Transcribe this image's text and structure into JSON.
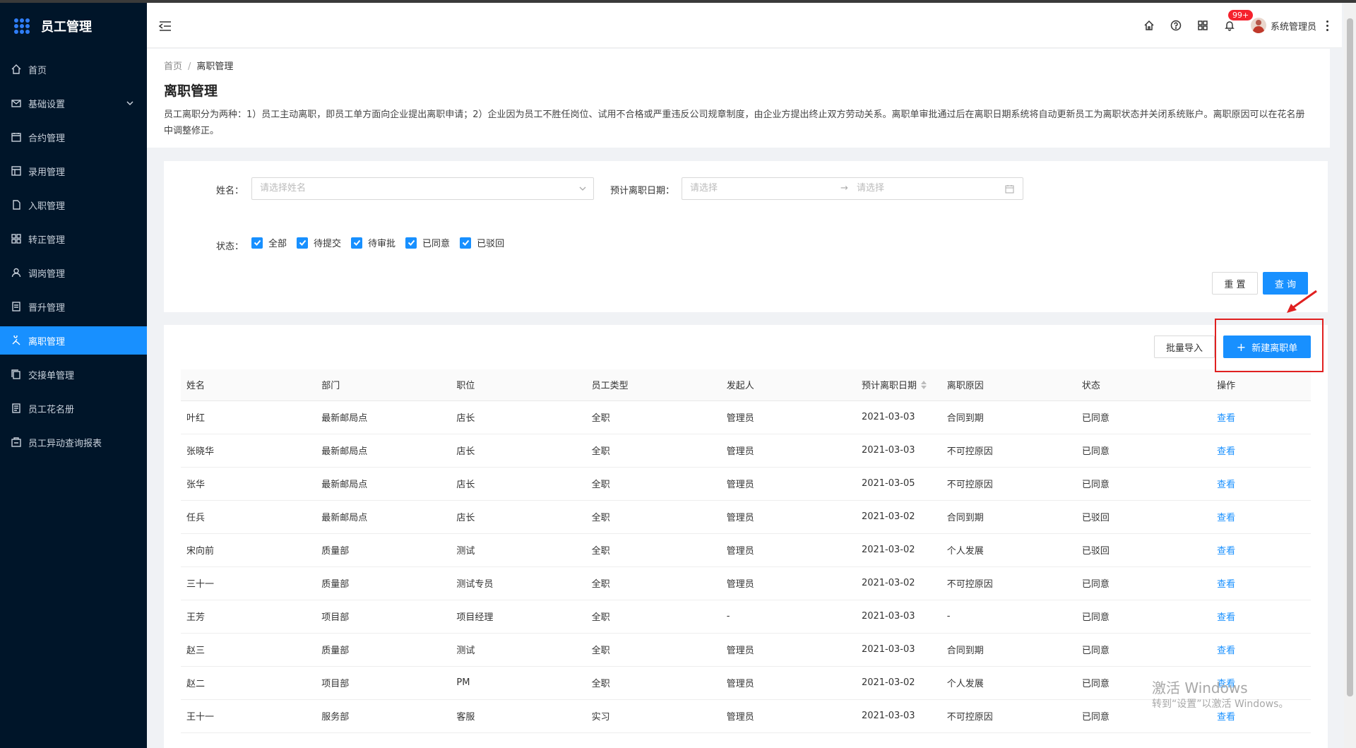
{
  "app": {
    "title": "员工管理"
  },
  "sidebar": {
    "items": [
      {
        "label": "首页",
        "icon": "home-icon"
      },
      {
        "label": "基础设置",
        "icon": "mail-icon",
        "expandable": true
      },
      {
        "label": "合约管理",
        "icon": "calendar-icon"
      },
      {
        "label": "录用管理",
        "icon": "grid-icon"
      },
      {
        "label": "入职管理",
        "icon": "doc-icon"
      },
      {
        "label": "转正管理",
        "icon": "tiles-icon"
      },
      {
        "label": "调岗管理",
        "icon": "user-icon"
      },
      {
        "label": "晋升管理",
        "icon": "file-icon"
      },
      {
        "label": "离职管理",
        "icon": "leave-icon",
        "active": true
      },
      {
        "label": "交接单管理",
        "icon": "copy-icon"
      },
      {
        "label": "员工花名册",
        "icon": "roster-icon"
      },
      {
        "label": "员工异动查询报表",
        "icon": "report-icon"
      }
    ]
  },
  "header": {
    "notification_badge": "99+",
    "username": "系统管理员"
  },
  "breadcrumb": {
    "home": "首页",
    "current": "离职管理"
  },
  "page": {
    "title": "离职管理",
    "description": "员工离职分为两种：1）员工主动离职，即员工单方面向企业提出离职申请；2）企业因为员工不胜任岗位、试用不合格或严重违反公司规章制度，由企业方提出终止双方劳动关系。离职单审批通过后在离职日期系统将自动更新员工为离职状态并关闭系统账户。离职原因可以在花名册中调整修正。"
  },
  "filters": {
    "name_label": "姓名：",
    "name_placeholder": "请选择姓名",
    "date_label": "预计离职日期：",
    "date_start_placeholder": "请选择",
    "date_end_placeholder": "请选择",
    "status_label": "状态：",
    "statuses": [
      "全部",
      "待提交",
      "待审批",
      "已同意",
      "已驳回"
    ],
    "reset_label": "重 置",
    "query_label": "查 询"
  },
  "actions": {
    "import_label": "批量导入",
    "new_label": "新建离职单"
  },
  "table": {
    "columns": [
      "姓名",
      "部门",
      "职位",
      "员工类型",
      "发起人",
      "预计离职日期",
      "离职原因",
      "状态",
      "操作"
    ],
    "rows": [
      [
        "叶红",
        "最新邮局点",
        "店长",
        "全职",
        "管理员",
        "2021-03-03",
        "合同到期",
        "已同意",
        "查看"
      ],
      [
        "张晓华",
        "最新邮局点",
        "店长",
        "全职",
        "管理员",
        "2021-03-03",
        "不可控原因",
        "已同意",
        "查看"
      ],
      [
        "张华",
        "最新邮局点",
        "店长",
        "全职",
        "管理员",
        "2021-03-05",
        "不可控原因",
        "已同意",
        "查看"
      ],
      [
        "任兵",
        "最新邮局点",
        "店长",
        "全职",
        "管理员",
        "2021-03-02",
        "合同到期",
        "已驳回",
        "查看"
      ],
      [
        "宋向前",
        "质量部",
        "测试",
        "全职",
        "管理员",
        "2021-03-02",
        "个人发展",
        "已驳回",
        "查看"
      ],
      [
        "三十一",
        "质量部",
        "测试专员",
        "全职",
        "管理员",
        "2021-03-02",
        "不可控原因",
        "已同意",
        "查看"
      ],
      [
        "王芳",
        "项目部",
        "项目经理",
        "全职",
        "-",
        "2021-03-03",
        "-",
        "已同意",
        "查看"
      ],
      [
        "赵三",
        "质量部",
        "测试",
        "全职",
        "管理员",
        "2021-03-03",
        "合同到期",
        "已同意",
        "查看"
      ],
      [
        "赵二",
        "项目部",
        "PM",
        "全职",
        "管理员",
        "2021-03-02",
        "个人发展",
        "已同意",
        "查看"
      ],
      [
        "王十一",
        "服务部",
        "客服",
        "实习",
        "管理员",
        "2021-03-03",
        "不可控原因",
        "已同意",
        "查看"
      ]
    ]
  },
  "watermark": {
    "line1": "激活 Windows",
    "line2": "转到“设置”以激活 Windows。"
  },
  "colors": {
    "sidebar": "#001529",
    "primary": "#1890ff",
    "highlight": "#e02020"
  }
}
